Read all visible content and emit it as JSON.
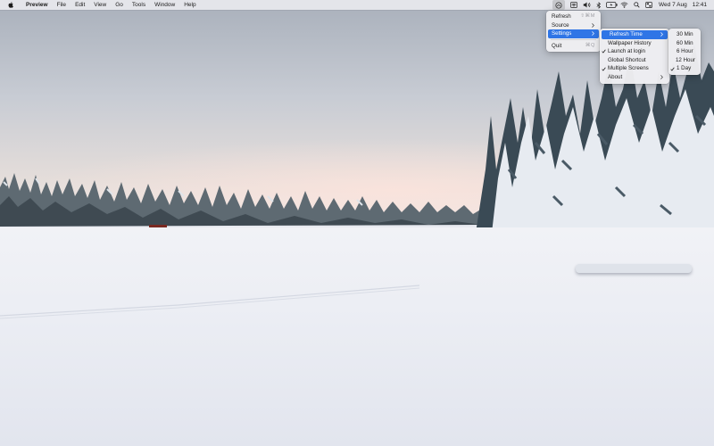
{
  "menubar": {
    "app_name": "Preview",
    "menus": [
      "File",
      "Edit",
      "View",
      "Go",
      "Tools",
      "Window",
      "Help"
    ],
    "status_icons": [
      "wallpaper-app-icon",
      "keyboard-layout-icon",
      "volume-icon",
      "bluetooth-icon",
      "battery-icon",
      "wifi-icon",
      "search-icon",
      "control-center-icon"
    ],
    "clock": {
      "date": "Wed 7 Aug",
      "time": "12:41"
    }
  },
  "app_menu": {
    "items": [
      {
        "label": "Refresh",
        "shortcut": "⇧⌘M",
        "submenu": false
      },
      {
        "label": "Source",
        "shortcut": "",
        "submenu": true
      },
      {
        "label": "Settings",
        "shortcut": "",
        "submenu": true,
        "highlighted": true
      },
      {
        "label": "Quit",
        "shortcut": "⌘Q",
        "submenu": false
      }
    ]
  },
  "settings_menu": {
    "items": [
      {
        "label": "Refresh Time",
        "submenu": true,
        "highlighted": true,
        "checked": false
      },
      {
        "label": "Wallpaper History",
        "submenu": false,
        "checked": false
      },
      {
        "label": "Launch at login",
        "submenu": false,
        "checked": true
      },
      {
        "label": "Global Shortcut",
        "submenu": false,
        "checked": false
      },
      {
        "label": "Multiple Screens",
        "submenu": false,
        "checked": true
      },
      {
        "label": "About",
        "submenu": true,
        "checked": false
      }
    ]
  },
  "refresh_time_menu": {
    "items": [
      {
        "label": "30 Min",
        "checked": false
      },
      {
        "label": "60 Min",
        "checked": false
      },
      {
        "label": "6 Hour",
        "checked": false
      },
      {
        "label": "12 Hour",
        "checked": false
      },
      {
        "label": "1 Day",
        "checked": true
      }
    ]
  },
  "colors": {
    "menu_highlight": "#2f75e6",
    "menubar_bg": "#ececf0"
  }
}
